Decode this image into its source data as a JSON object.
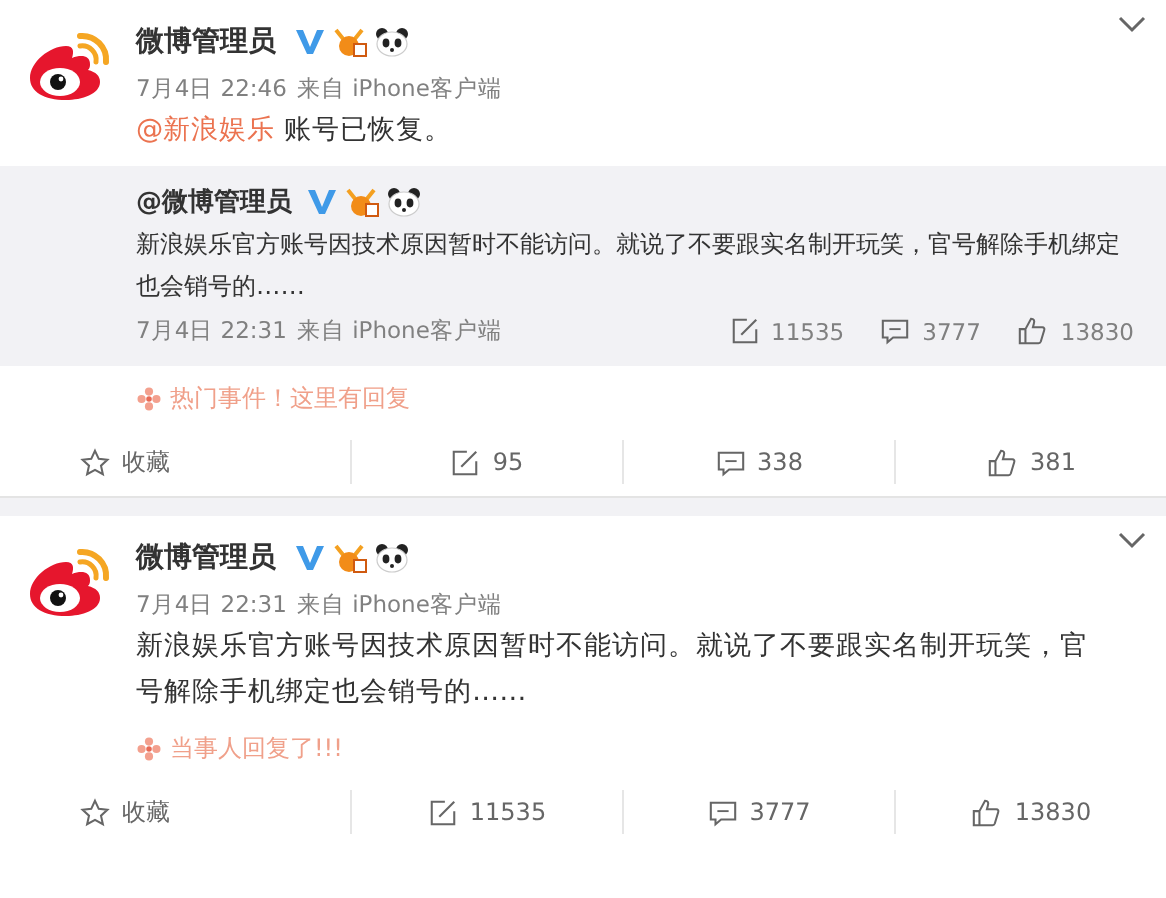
{
  "posts": [
    {
      "author": "微博管理员",
      "time": "7月4日 22:46",
      "source": "来自 iPhone客户端",
      "mention": "@新浪娱乐",
      "text": "账号已恢复。",
      "repost": {
        "author": "@微博管理员",
        "text": "新浪娱乐官方账号因技术原因暂时不能访问。就说了不要跟实名制开玩笑，官号解除手机绑定也会销号的……",
        "time": "7月4日 22:31",
        "source": "来自 iPhone客户端",
        "counts": [
          {
            "kind": "repost",
            "label": "11535"
          },
          {
            "kind": "comment",
            "label": "3777"
          },
          {
            "kind": "like",
            "label": "13830"
          }
        ]
      },
      "topic": "热门事件！这里有回复",
      "actions": [
        {
          "kind": "favorite",
          "label": "收藏"
        },
        {
          "kind": "repost",
          "label": "95"
        },
        {
          "kind": "comment",
          "label": "338"
        },
        {
          "kind": "like",
          "label": "381"
        }
      ]
    },
    {
      "author": "微博管理员",
      "time": "7月4日 22:31",
      "source": "来自 iPhone客户端",
      "text": "新浪娱乐官方账号因技术原因暂时不能访问。就说了不要跟实名制开玩笑，官号解除手机绑定也会销号的……",
      "topic": "当事人回复了!!!",
      "actions": [
        {
          "kind": "favorite",
          "label": "收藏"
        },
        {
          "kind": "repost",
          "label": "11535"
        },
        {
          "kind": "comment",
          "label": "3777"
        },
        {
          "kind": "like",
          "label": "13830"
        }
      ]
    }
  ]
}
